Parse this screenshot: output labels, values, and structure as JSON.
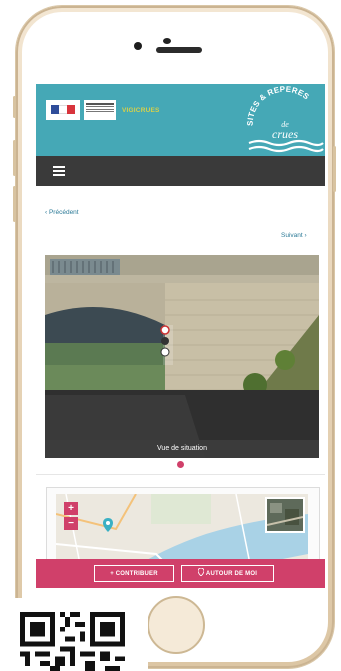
{
  "header": {
    "partner_text": "VIGICRUES",
    "brand_line1": "SITES & REPÈRES",
    "brand_line2": "de",
    "brand_line3": "crues"
  },
  "nav": {
    "previous_label": "‹ Précédent",
    "next_label": "Suivant ›"
  },
  "photo": {
    "caption": "Vue de situation"
  },
  "map": {
    "zoom_in": "+",
    "zoom_out": "−"
  },
  "actions": {
    "contribute_label": "+ CONTRIBUER",
    "around_me_label": "AUTOUR DE MOI"
  },
  "colors": {
    "header_teal": "#45a8b6",
    "accent_pink": "#d0406a",
    "navbar_dark": "#3a3a3a",
    "link_blue": "#2d7b98"
  }
}
